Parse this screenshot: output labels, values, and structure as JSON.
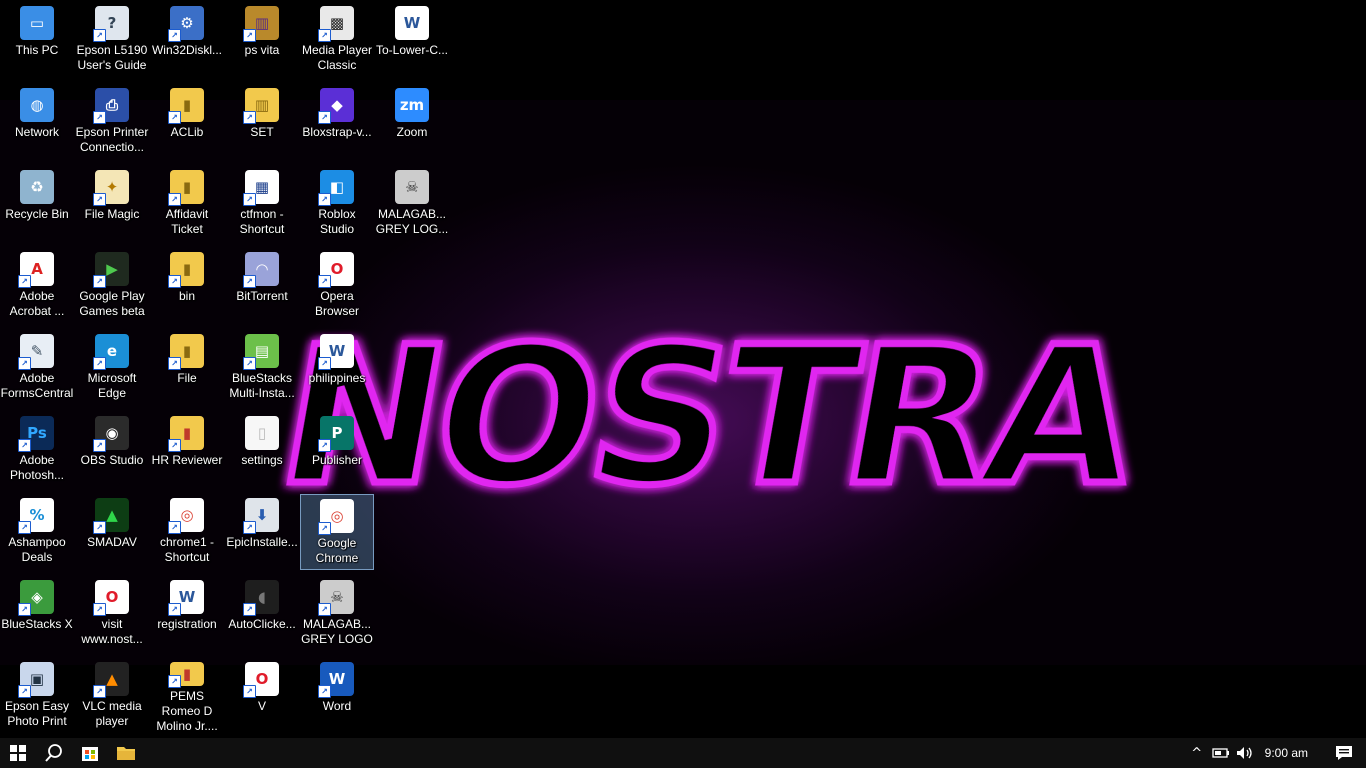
{
  "wallpaper": {
    "text": "NOSTRA",
    "accent": "#e026f0"
  },
  "desktop": {
    "icons": [
      {
        "label": "This PC",
        "name": "this-pc",
        "icon": "computer-icon",
        "bg": "#3a8ee6",
        "glyph": "▭",
        "col": 0,
        "row": 0,
        "shortcut": false
      },
      {
        "label": "Network",
        "name": "network",
        "icon": "network-icon",
        "bg": "#3a8ee6",
        "glyph": "◍",
        "col": 0,
        "row": 1,
        "shortcut": false
      },
      {
        "label": "Recycle Bin",
        "name": "recycle-bin",
        "icon": "recycle-bin-icon",
        "bg": "#8fb4cf",
        "glyph": "♻",
        "col": 0,
        "row": 2,
        "shortcut": false
      },
      {
        "label": "Adobe Acrobat ...",
        "name": "adobe-acrobat",
        "icon": "pdf-icon",
        "bg": "#ffffff",
        "fg": "#d22",
        "glyph": "A",
        "col": 0,
        "row": 3,
        "shortcut": true
      },
      {
        "label": "Adobe FormsCentral",
        "name": "adobe-formscentral",
        "icon": "forms-icon",
        "bg": "#e8eef5",
        "fg": "#456",
        "glyph": "✎",
        "col": 0,
        "row": 4,
        "shortcut": true
      },
      {
        "label": "Adobe Photosh...",
        "name": "adobe-photoshop",
        "icon": "photoshop-icon",
        "bg": "#0b2a57",
        "fg": "#31a8ff",
        "glyph": "Ps",
        "col": 0,
        "row": 5,
        "shortcut": true
      },
      {
        "label": "Ashampoo Deals",
        "name": "ashampoo-deals",
        "icon": "deals-icon",
        "bg": "#ffffff",
        "fg": "#1a8fd6",
        "glyph": "%",
        "col": 0,
        "row": 6,
        "shortcut": true
      },
      {
        "label": "BlueStacks X",
        "name": "bluestacks-x",
        "icon": "bluestacks-icon",
        "bg": "#3b9b3d",
        "glyph": "◈",
        "col": 0,
        "row": 7,
        "shortcut": true
      },
      {
        "label": "Epson Easy Photo Print",
        "name": "epson-easy-photo-print",
        "icon": "photo-print-icon",
        "bg": "#c9d7ec",
        "fg": "#234",
        "glyph": "▣",
        "col": 0,
        "row": 8,
        "shortcut": true
      },
      {
        "label": "Epson L5190 User's Guide",
        "name": "epson-user-guide",
        "icon": "guide-icon",
        "bg": "#dfe6ee",
        "fg": "#345",
        "glyph": "?",
        "col": 1,
        "row": 0,
        "shortcut": true
      },
      {
        "label": "Epson Printer Connectio...",
        "name": "epson-printer-connection",
        "icon": "printer-icon",
        "bg": "#2b4fa8",
        "glyph": "⎙",
        "col": 1,
        "row": 1,
        "shortcut": true
      },
      {
        "label": "File Magic",
        "name": "file-magic",
        "icon": "file-magic-icon",
        "bg": "#f4e6b6",
        "fg": "#b37a00",
        "glyph": "✦",
        "col": 1,
        "row": 2,
        "shortcut": true
      },
      {
        "label": "Google Play Games beta",
        "name": "google-play-games",
        "icon": "play-games-icon",
        "bg": "#1f2a1f",
        "fg": "#4ec94e",
        "glyph": "▶",
        "col": 1,
        "row": 3,
        "shortcut": true
      },
      {
        "label": "Microsoft Edge",
        "name": "microsoft-edge",
        "icon": "edge-icon",
        "bg": "#1b8fd6",
        "glyph": "e",
        "col": 1,
        "row": 4,
        "shortcut": true
      },
      {
        "label": "OBS Studio",
        "name": "obs-studio",
        "icon": "obs-icon",
        "bg": "#2b2b2b",
        "glyph": "◉",
        "col": 1,
        "row": 5,
        "shortcut": true
      },
      {
        "label": "SMADAV",
        "name": "smadav",
        "icon": "smadav-icon",
        "bg": "#0d3d14",
        "fg": "#2fd64a",
        "glyph": "▲",
        "col": 1,
        "row": 6,
        "shortcut": true
      },
      {
        "label": "visit www.nost...",
        "name": "visit-nostra",
        "icon": "opera-icon",
        "bg": "#ffffff",
        "fg": "#e01b2a",
        "glyph": "O",
        "col": 1,
        "row": 7,
        "shortcut": true
      },
      {
        "label": "VLC media player",
        "name": "vlc-media-player",
        "icon": "vlc-icon",
        "bg": "#222222",
        "fg": "#ff8c00",
        "glyph": "▲",
        "col": 1,
        "row": 8,
        "shortcut": true
      },
      {
        "label": "Win32Diskl...",
        "name": "win32diskimager",
        "icon": "disk-imager-icon",
        "bg": "#3b6fc7",
        "glyph": "⚙",
        "col": 2,
        "row": 0,
        "shortcut": true
      },
      {
        "label": "ACLib",
        "name": "aclib",
        "icon": "folder-icon",
        "bg": "#f2c94c",
        "fg": "#8a6a10",
        "glyph": "▮",
        "col": 2,
        "row": 1,
        "shortcut": true
      },
      {
        "label": "Affidavit Ticket",
        "name": "affidavit-ticket",
        "icon": "folder-icon",
        "bg": "#f2c94c",
        "fg": "#8a6a10",
        "glyph": "▮",
        "col": 2,
        "row": 2,
        "shortcut": true
      },
      {
        "label": "bin",
        "name": "bin",
        "icon": "folder-icon",
        "bg": "#f2c94c",
        "fg": "#8a6a10",
        "glyph": "▮",
        "col": 2,
        "row": 3,
        "shortcut": true
      },
      {
        "label": "File",
        "name": "file",
        "icon": "folder-icon",
        "bg": "#f2c94c",
        "fg": "#8a6a10",
        "glyph": "▮",
        "col": 2,
        "row": 4,
        "shortcut": true
      },
      {
        "label": "HR Reviewer",
        "name": "hr-reviewer",
        "icon": "pdf-folder-icon",
        "bg": "#f2c94c",
        "fg": "#c0392b",
        "glyph": "▮",
        "col": 2,
        "row": 5,
        "shortcut": true
      },
      {
        "label": "chrome1 - Shortcut",
        "name": "chrome1-shortcut",
        "icon": "chrome-icon",
        "bg": "#ffffff",
        "fg": "#db4437",
        "glyph": "◎",
        "col": 2,
        "row": 6,
        "shortcut": true
      },
      {
        "label": "registration",
        "name": "registration",
        "icon": "word-doc-icon",
        "bg": "#ffffff",
        "fg": "#2b579a",
        "glyph": "W",
        "col": 2,
        "row": 7,
        "shortcut": true
      },
      {
        "label": "PEMS Romeo D Molino Jr....",
        "name": "pems-romeo",
        "icon": "pdf-folder-icon",
        "bg": "#f2c94c",
        "fg": "#c0392b",
        "glyph": "▮",
        "col": 2,
        "row": 8,
        "shortcut": true
      },
      {
        "label": "ps vita",
        "name": "ps-vita",
        "icon": "archive-icon",
        "bg": "#b9892b",
        "fg": "#5a2d80",
        "glyph": "▥",
        "col": 3,
        "row": 0,
        "shortcut": true
      },
      {
        "label": "SET",
        "name": "set",
        "icon": "archive-icon",
        "bg": "#f2c94c",
        "fg": "#8a6a10",
        "glyph": "▥",
        "col": 3,
        "row": 1,
        "shortcut": true
      },
      {
        "label": "ctfmon - Shortcut",
        "name": "ctfmon-shortcut",
        "icon": "ctfmon-icon",
        "bg": "#ffffff",
        "fg": "#1a3d8a",
        "glyph": "▦",
        "col": 3,
        "row": 2,
        "shortcut": true
      },
      {
        "label": "BitTorrent",
        "name": "bittorrent",
        "icon": "bittorrent-icon",
        "bg": "#9aa3d9",
        "fg": "#ffffff",
        "glyph": "◠",
        "col": 3,
        "row": 3,
        "shortcut": true
      },
      {
        "label": "BlueStacks Multi-Insta...",
        "name": "bluestacks-multi-instance",
        "icon": "bluestacks-multi-icon",
        "bg": "#6cc04a",
        "glyph": "▤",
        "col": 3,
        "row": 4,
        "shortcut": true
      },
      {
        "label": "settings",
        "name": "settings",
        "icon": "blank-file-icon",
        "bg": "#f7f7f7",
        "fg": "#bbb",
        "glyph": "▯",
        "col": 3,
        "row": 5,
        "shortcut": false
      },
      {
        "label": "EpicInstalle...",
        "name": "epic-installer",
        "icon": "installer-icon",
        "bg": "#dfe4ea",
        "fg": "#2a5db0",
        "glyph": "⬇",
        "col": 3,
        "row": 6,
        "shortcut": true
      },
      {
        "label": "AutoClicke...",
        "name": "autoclicker",
        "icon": "mouse-icon",
        "bg": "#1e1e1e",
        "fg": "#777",
        "glyph": "◖",
        "col": 3,
        "row": 7,
        "shortcut": true
      },
      {
        "label": "V",
        "name": "v",
        "icon": "opera-icon",
        "bg": "#ffffff",
        "fg": "#e01b2a",
        "glyph": "O",
        "col": 3,
        "row": 8,
        "shortcut": true
      },
      {
        "label": "Media Player Classic",
        "name": "media-player-classic",
        "icon": "clapper-icon",
        "bg": "#e9e9e9",
        "fg": "#222",
        "glyph": "▩",
        "col": 4,
        "row": 0,
        "shortcut": true
      },
      {
        "label": "Bloxstrap-v...",
        "name": "bloxstrap",
        "icon": "bloxstrap-icon",
        "bg": "#5b2fd6",
        "glyph": "◆",
        "col": 4,
        "row": 1,
        "shortcut": true
      },
      {
        "label": "Roblox Studio",
        "name": "roblox-studio",
        "icon": "roblox-studio-icon",
        "bg": "#1c8de4",
        "glyph": "◧",
        "col": 4,
        "row": 2,
        "shortcut": true
      },
      {
        "label": "Opera Browser",
        "name": "opera-browser",
        "icon": "opera-icon",
        "bg": "#ffffff",
        "fg": "#e01b2a",
        "glyph": "O",
        "col": 4,
        "row": 3,
        "shortcut": true
      },
      {
        "label": "philippines",
        "name": "philippines",
        "icon": "word-doc-icon",
        "bg": "#ffffff",
        "fg": "#2b579a",
        "glyph": "W",
        "col": 4,
        "row": 4,
        "shortcut": true
      },
      {
        "label": "Publisher",
        "name": "publisher",
        "icon": "publisher-icon",
        "bg": "#077568",
        "glyph": "P",
        "col": 4,
        "row": 5,
        "shortcut": true
      },
      {
        "label": "Google Chrome",
        "name": "google-chrome",
        "icon": "chrome-icon",
        "bg": "#ffffff",
        "fg": "#db4437",
        "glyph": "◎",
        "col": 4,
        "row": 6,
        "shortcut": true,
        "selected": true
      },
      {
        "label": "MALAGAB... GREY LOGO",
        "name": "malagab-grey-logo",
        "icon": "skull-icon",
        "bg": "#cccccc",
        "fg": "#333",
        "glyph": "☠",
        "col": 4,
        "row": 7,
        "shortcut": true
      },
      {
        "label": "Word",
        "name": "word",
        "icon": "word-icon",
        "bg": "#185abd",
        "glyph": "W",
        "col": 4,
        "row": 8,
        "shortcut": true
      },
      {
        "label": "To-Lower-C...",
        "name": "to-lower-case",
        "icon": "word-doc-icon",
        "bg": "#ffffff",
        "fg": "#2b579a",
        "glyph": "W",
        "col": 5,
        "row": 0,
        "shortcut": false
      },
      {
        "label": "Zoom",
        "name": "zoom",
        "icon": "zoom-icon",
        "bg": "#2d8cff",
        "glyph": "zm",
        "col": 5,
        "row": 1,
        "shortcut": false
      },
      {
        "label": "MALAGAB... GREY LOG...",
        "name": "malagab-grey-logo-2",
        "icon": "skull-icon",
        "bg": "#cccccc",
        "fg": "#333",
        "glyph": "☠",
        "col": 5,
        "row": 2,
        "shortcut": false
      }
    ]
  },
  "taskbar": {
    "start_icon": "windows-start-icon",
    "search_icon": "search-icon",
    "store_icon": "microsoft-store-icon",
    "explorer_icon": "file-explorer-icon",
    "tray": {
      "chevron": "^",
      "clock": "9:00 am"
    }
  }
}
